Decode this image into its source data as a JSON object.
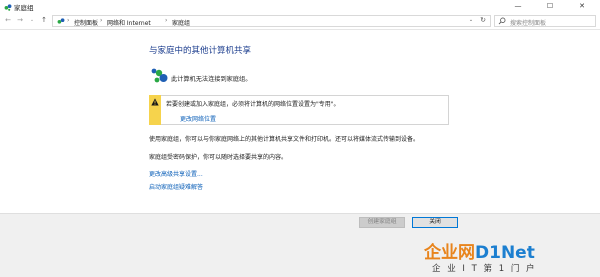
{
  "window": {
    "title": "家庭组",
    "minimize_glyph": "—",
    "maximize_glyph": "☐",
    "close_glyph": "✕"
  },
  "address": {
    "breadcrumbs": [
      "控制面板",
      "网络和 Internet",
      "家庭组"
    ],
    "search_placeholder": "搜索控制面板"
  },
  "main": {
    "heading": "与家庭中的其他计算机共享",
    "status_text": "此计算机无法连接到家庭组。",
    "warning": {
      "message": "若要创建或加入家庭组，必须将计算机的网络位置设置为\"专用\"。",
      "link": "更改网络位置"
    },
    "paragraph1": "使用家庭组，你可以与你家庭网络上的其他计算机共享文件和打印机。还可以将媒体流式传输到设备。",
    "paragraph2": "家庭组受密码保护，你可以随时选择要共享的内容。",
    "link_advanced": "更改高级共享设置...",
    "link_troubleshoot": "启动家庭组疑难解答"
  },
  "buttons": {
    "create": "创建家庭组",
    "close": "关闭"
  },
  "watermark": {
    "logo_part1": "企业网",
    "logo_part2": "D1Net",
    "tagline": "企 业 I T 第 1 门 户"
  },
  "colors": {
    "heading": "#1e3f8f",
    "link": "#0b5fb8",
    "warning_stripe": "#f6d34c",
    "close_button_border": "#0078d7",
    "homegroup_green": "#2aa845",
    "homegroup_blue": "#1f5fb4"
  },
  "icons": {
    "app": "homegroup-icon",
    "status": "homegroup-large-icon",
    "warning": "warning-icon"
  }
}
